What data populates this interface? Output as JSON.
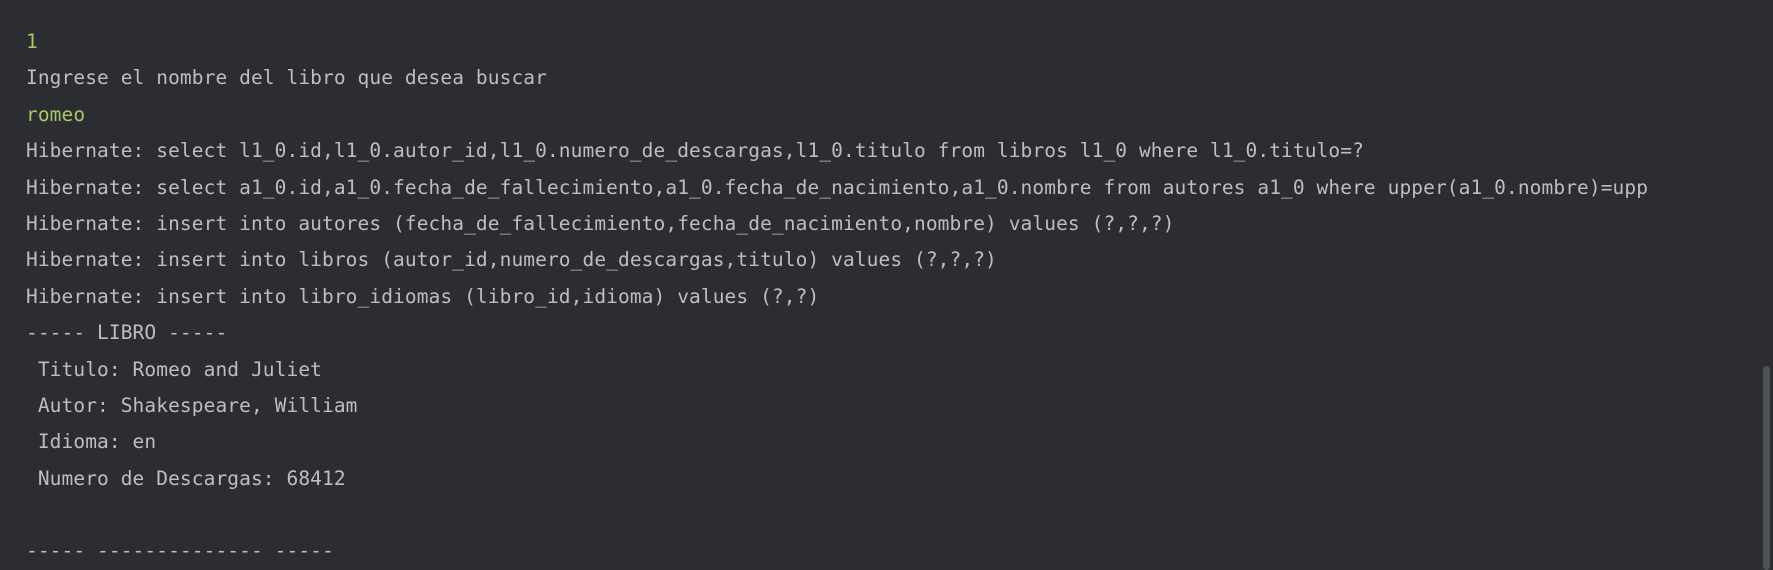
{
  "console": {
    "lines": [
      {
        "text": "1",
        "kind": "input"
      },
      {
        "text": "Ingrese el nombre del libro que desea buscar",
        "kind": "output"
      },
      {
        "text": "romeo",
        "kind": "input"
      },
      {
        "text": "Hibernate: select l1_0.id,l1_0.autor_id,l1_0.numero_de_descargas,l1_0.titulo from libros l1_0 where l1_0.titulo=?",
        "kind": "output"
      },
      {
        "text": "Hibernate: select a1_0.id,a1_0.fecha_de_fallecimiento,a1_0.fecha_de_nacimiento,a1_0.nombre from autores a1_0 where upper(a1_0.nombre)=upp",
        "kind": "output"
      },
      {
        "text": "Hibernate: insert into autores (fecha_de_fallecimiento,fecha_de_nacimiento,nombre) values (?,?,?)",
        "kind": "output"
      },
      {
        "text": "Hibernate: insert into libros (autor_id,numero_de_descargas,titulo) values (?,?,?)",
        "kind": "output"
      },
      {
        "text": "Hibernate: insert into libro_idiomas (libro_id,idioma) values (?,?)",
        "kind": "output"
      },
      {
        "text": "----- LIBRO -----",
        "kind": "output"
      },
      {
        "text": " Titulo: Romeo and Juliet",
        "kind": "output"
      },
      {
        "text": " Autor: Shakespeare, William",
        "kind": "output"
      },
      {
        "text": " Idioma: en",
        "kind": "output"
      },
      {
        "text": " Numero de Descargas: 68412",
        "kind": "output"
      },
      {
        "text": "",
        "kind": "output"
      },
      {
        "text": "----- -------------- -----",
        "kind": "output"
      }
    ]
  },
  "colors": {
    "background": "#2b2d30",
    "output_text": "#bcbec4",
    "input_text": "#a8c76a",
    "scroll_thumb": "#4e5157"
  }
}
